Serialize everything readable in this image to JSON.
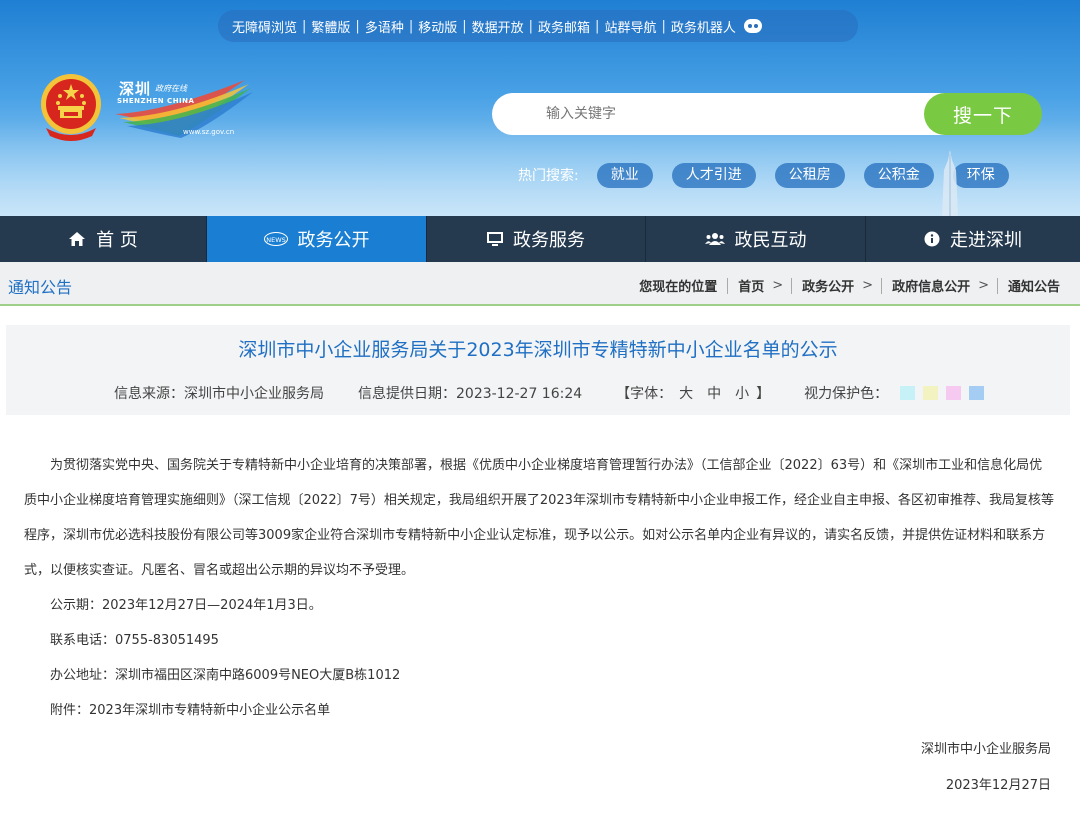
{
  "top_links": [
    "无障碍浏览",
    "繁體版",
    "多语种",
    "移动版",
    "数据开放",
    "政务邮箱",
    "站群导航",
    "政务机器人"
  ],
  "logo": {
    "cn": "深圳",
    "cn_sub": "政府在线",
    "en": "SHENZHEN CHINA",
    "url": "www.sz.gov.cn"
  },
  "search": {
    "placeholder": "输入关键字",
    "button": "搜一下"
  },
  "hot_search": {
    "label": "热门搜索:",
    "tags": [
      "就业",
      "人才引进",
      "公租房",
      "公积金",
      "环保"
    ]
  },
  "nav": [
    {
      "label": "首 页",
      "icon": "home-icon"
    },
    {
      "label": "政务公开",
      "icon": "news-icon"
    },
    {
      "label": "政务服务",
      "icon": "monitor-icon"
    },
    {
      "label": "政民互动",
      "icon": "people-icon"
    },
    {
      "label": "走进深圳",
      "icon": "info-icon"
    }
  ],
  "breadcrumb": {
    "section": "通知公告",
    "location_label": "您现在的位置",
    "path": [
      "首页",
      "政务公开",
      "政府信息公开",
      "通知公告"
    ]
  },
  "article": {
    "title": "深圳市中小企业服务局关于2023年深圳市专精特新中小企业名单的公示",
    "source": "信息来源：深圳市中小企业服务局",
    "date": "信息提供日期：2023-12-27 16:24",
    "font_label": "【字体：",
    "font_sizes": [
      "大",
      "中",
      "小"
    ],
    "font_close": "】",
    "eye_label": "视力保护色：",
    "eye_colors": [
      "#c6f2f7",
      "#f3f3c2",
      "#f6c9f1",
      "#a5cdf3"
    ],
    "body": "为贯彻落实党中央、国务院关于专精特新中小企业培育的决策部署，根据《优质中小企业梯度培育管理暂行办法》（工信部企业〔2022〕63号）和《深圳市工业和信息化局优质中小企业梯度培育管理实施细则》（深工信规〔2022〕7号）相关规定，我局组织开展了2023年深圳市专精特新中小企业申报工作，经企业自主申报、各区初审推荐、我局复核等程序，深圳市优必选科技股份有限公司等3009家企业符合深圳市专精特新中小企业认定标准，现予以公示。如对公示名单内企业有异议的，请实名反馈，并提供佐证材料和联系方式，以便核实查证。凡匿名、冒名或超出公示期的异议均不予受理。",
    "period": "公示期：2023年12月27日—2024年1月3日。",
    "phone": "联系电话：0755-83051495",
    "address": "办公地址：深圳市福田区深南中路6009号NEO大厦B栋1012",
    "attachment": "附件：2023年深圳市专精特新中小企业公示名单",
    "signer": "深圳市中小企业服务局",
    "sign_date": "2023年12月27日"
  }
}
